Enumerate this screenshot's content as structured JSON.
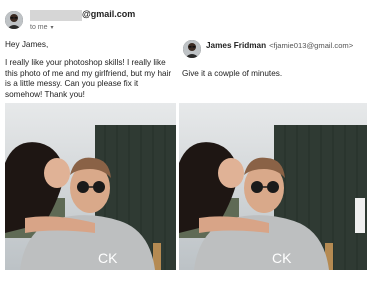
{
  "original_email": {
    "sender_domain": "@gmail.com",
    "recipient_label": "to me",
    "greeting": "Hey James,",
    "message": "I really like your photoshop skills! I really like this photo of me and my  girlfriend, but my hair is a little messy. Can you please fix it somehow! Thank you!",
    "avatar_icon": "user-avatar-icon",
    "dropdown_icon": "chevron-down-icon"
  },
  "reply_email": {
    "sender_name": "James Fridman",
    "sender_email": "<fjamie013@gmail.com>",
    "message": "Give it a cowple of minutes.",
    "avatar_icon": "user-avatar-icon"
  },
  "photos": {
    "hoodie_text": "CK"
  },
  "colors": {
    "redaction": "#d6d6d6",
    "text": "#222222",
    "muted": "#666666"
  }
}
